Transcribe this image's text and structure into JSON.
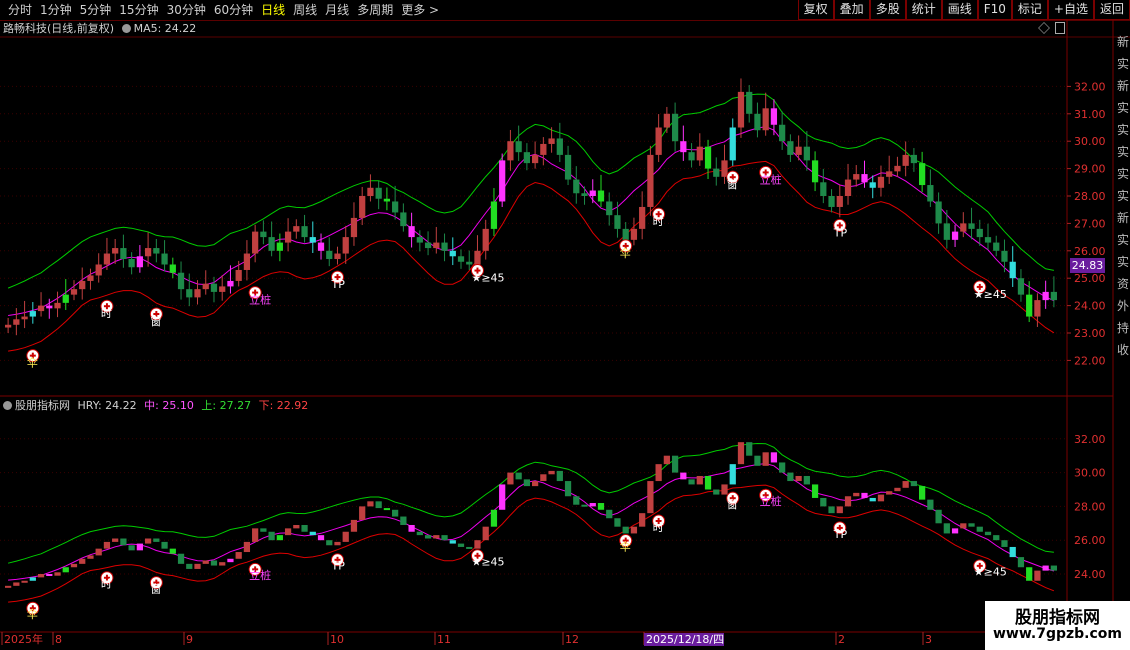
{
  "toolbar": {
    "left": [
      "分时",
      "1分钟",
      "5分钟",
      "15分钟",
      "30分钟",
      "60分钟",
      "日线",
      "周线",
      "月线",
      "多周期",
      "更多 >"
    ],
    "active": "日线",
    "right": [
      "复权",
      "叠加",
      "多股",
      "统计",
      "画线",
      "F10",
      "标记",
      "+自选",
      "返回"
    ]
  },
  "main_panel": {
    "title": "路畅科技(日线,前复权)",
    "ma_label": "MA5: 24.22",
    "current_price": "24.83",
    "y_ticks": [
      "32.00",
      "31.00",
      "30.00",
      "29.00",
      "28.00",
      "27.00",
      "26.00",
      "25.00",
      "24.00",
      "23.00",
      "22.00"
    ]
  },
  "sub_panel": {
    "title": "股朋指标网",
    "hry": "HRY: 24.22",
    "mid": "中: 25.10",
    "up": "上: 27.27",
    "down": "下: 22.92",
    "y_ticks": [
      "32.00",
      "30.00",
      "28.00",
      "26.00",
      "24.00"
    ]
  },
  "right_strip_chars": "新实新实实实实实新实实资外持收",
  "x_axis": [
    "2025年",
    "8",
    "9",
    "10",
    "11",
    "12",
    "2025/12/18/四",
    "2",
    "3"
  ],
  "watermark": {
    "line1": "股朋指标网",
    "line2": "www.7gpzb.com"
  },
  "chart_data": {
    "type": "candlestick",
    "ylim": [
      21.5,
      33.0
    ],
    "series": [
      {
        "name": "upper",
        "color": "#00d000"
      },
      {
        "name": "mid",
        "color": "#ff00ff"
      },
      {
        "name": "lower",
        "color": "#e00000"
      }
    ],
    "close": [
      23.3,
      23.5,
      23.6,
      23.8,
      24.0,
      23.9,
      24.1,
      24.4,
      24.6,
      24.9,
      25.1,
      25.5,
      25.9,
      26.1,
      25.7,
      25.4,
      25.8,
      26.1,
      25.9,
      25.5,
      25.2,
      24.6,
      24.3,
      24.6,
      24.8,
      24.5,
      24.7,
      24.9,
      25.3,
      25.9,
      26.7,
      26.5,
      26.0,
      26.3,
      26.7,
      26.9,
      26.5,
      26.3,
      26.0,
      25.7,
      25.9,
      26.5,
      27.2,
      28.0,
      28.3,
      27.9,
      27.8,
      27.4,
      26.9,
      26.5,
      26.3,
      26.1,
      26.3,
      26.0,
      25.8,
      25.6,
      25.5,
      26.0,
      26.8,
      27.8,
      29.3,
      30.0,
      29.6,
      29.2,
      29.5,
      29.9,
      30.1,
      29.5,
      28.6,
      28.1,
      28.0,
      28.2,
      27.8,
      27.3,
      26.8,
      26.4,
      26.8,
      27.6,
      29.5,
      30.5,
      31.0,
      30.0,
      29.6,
      29.3,
      29.8,
      29.0,
      28.7,
      29.3,
      30.5,
      31.8,
      31.0,
      30.4,
      31.2,
      30.6,
      30.0,
      29.5,
      29.8,
      29.3,
      28.5,
      28.0,
      27.6,
      28.0,
      28.6,
      28.8,
      28.5,
      28.3,
      28.7,
      28.9,
      29.1,
      29.5,
      29.2,
      28.4,
      27.8,
      27.0,
      26.4,
      26.7,
      27.0,
      26.8,
      26.5,
      26.3,
      26.0,
      25.6,
      25.0,
      24.4,
      23.6,
      24.2,
      24.5,
      24.2
    ],
    "labels": [
      "伞",
      "时",
      "窗",
      "立桩",
      "TP",
      "★≥45"
    ]
  }
}
